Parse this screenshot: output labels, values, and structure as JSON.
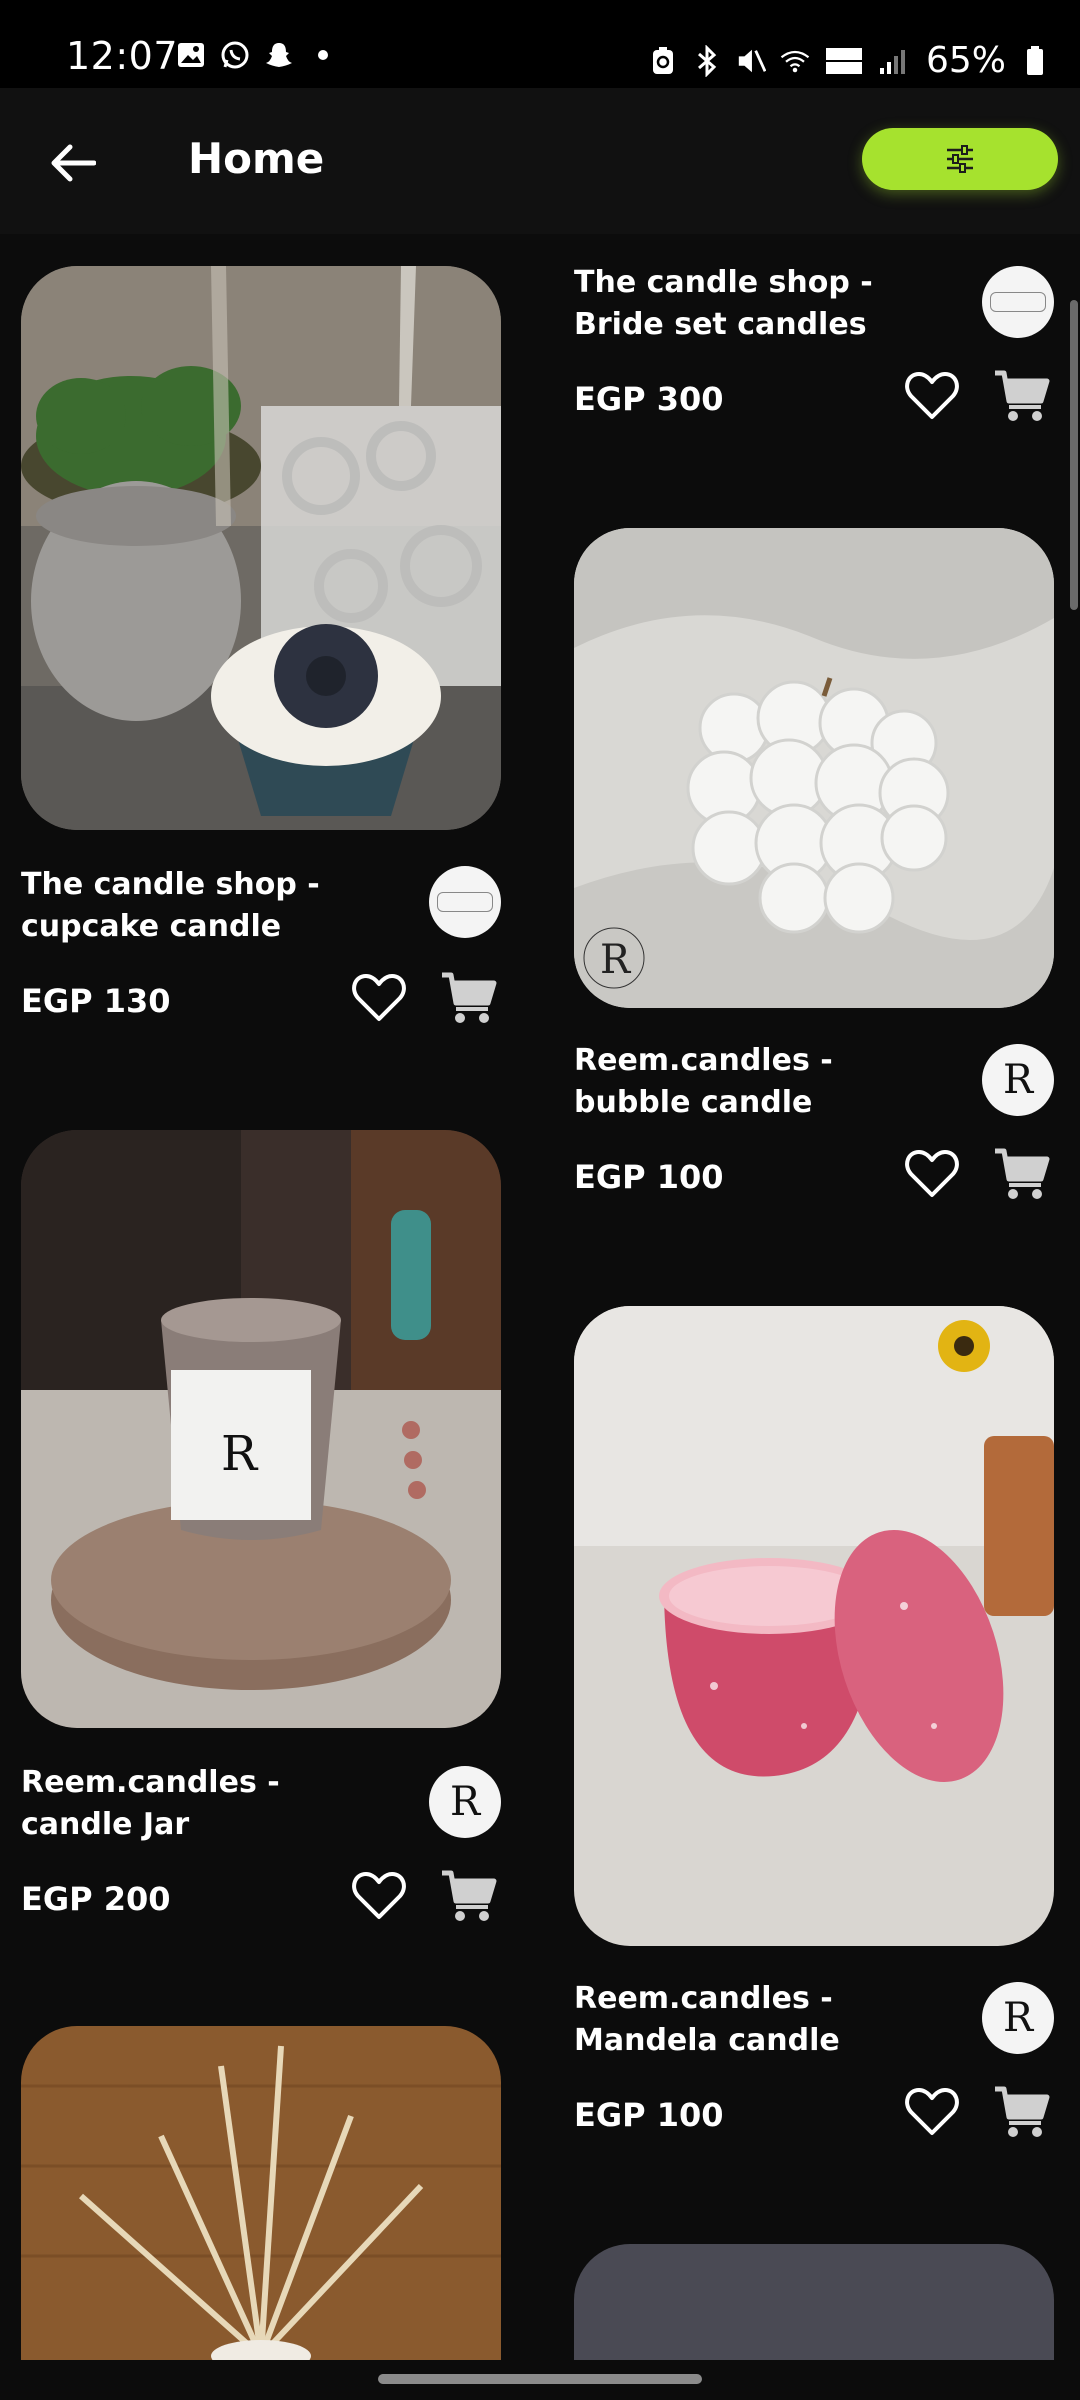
{
  "status_bar": {
    "time": "12:07",
    "battery": "65%"
  },
  "app_bar": {
    "title": "Home",
    "back_icon": "arrow-left-icon",
    "filter_icon": "sliders-icon",
    "accent": "#a6e22e"
  },
  "products": [
    {
      "name": "The candle shop - cupcake candle",
      "price": "EGP 130",
      "shop_avatar": "the-candle-shop-logo"
    },
    {
      "name": "The candle shop - Bride set candles",
      "price": "EGP 300",
      "shop_avatar": "the-candle-shop-logo"
    },
    {
      "name": "Reem.candles - bubble candle",
      "price": "EGP 100",
      "shop_avatar": "R"
    },
    {
      "name": "Reem.candles - candle Jar",
      "price": "EGP 200",
      "shop_avatar": "R"
    },
    {
      "name": "Reem.candles - Mandela candle",
      "price": "EGP 100",
      "shop_avatar": "R"
    }
  ],
  "colors": {
    "background": "#0c0c0c",
    "app_bar": "#111111",
    "text": "#ffffff"
  }
}
